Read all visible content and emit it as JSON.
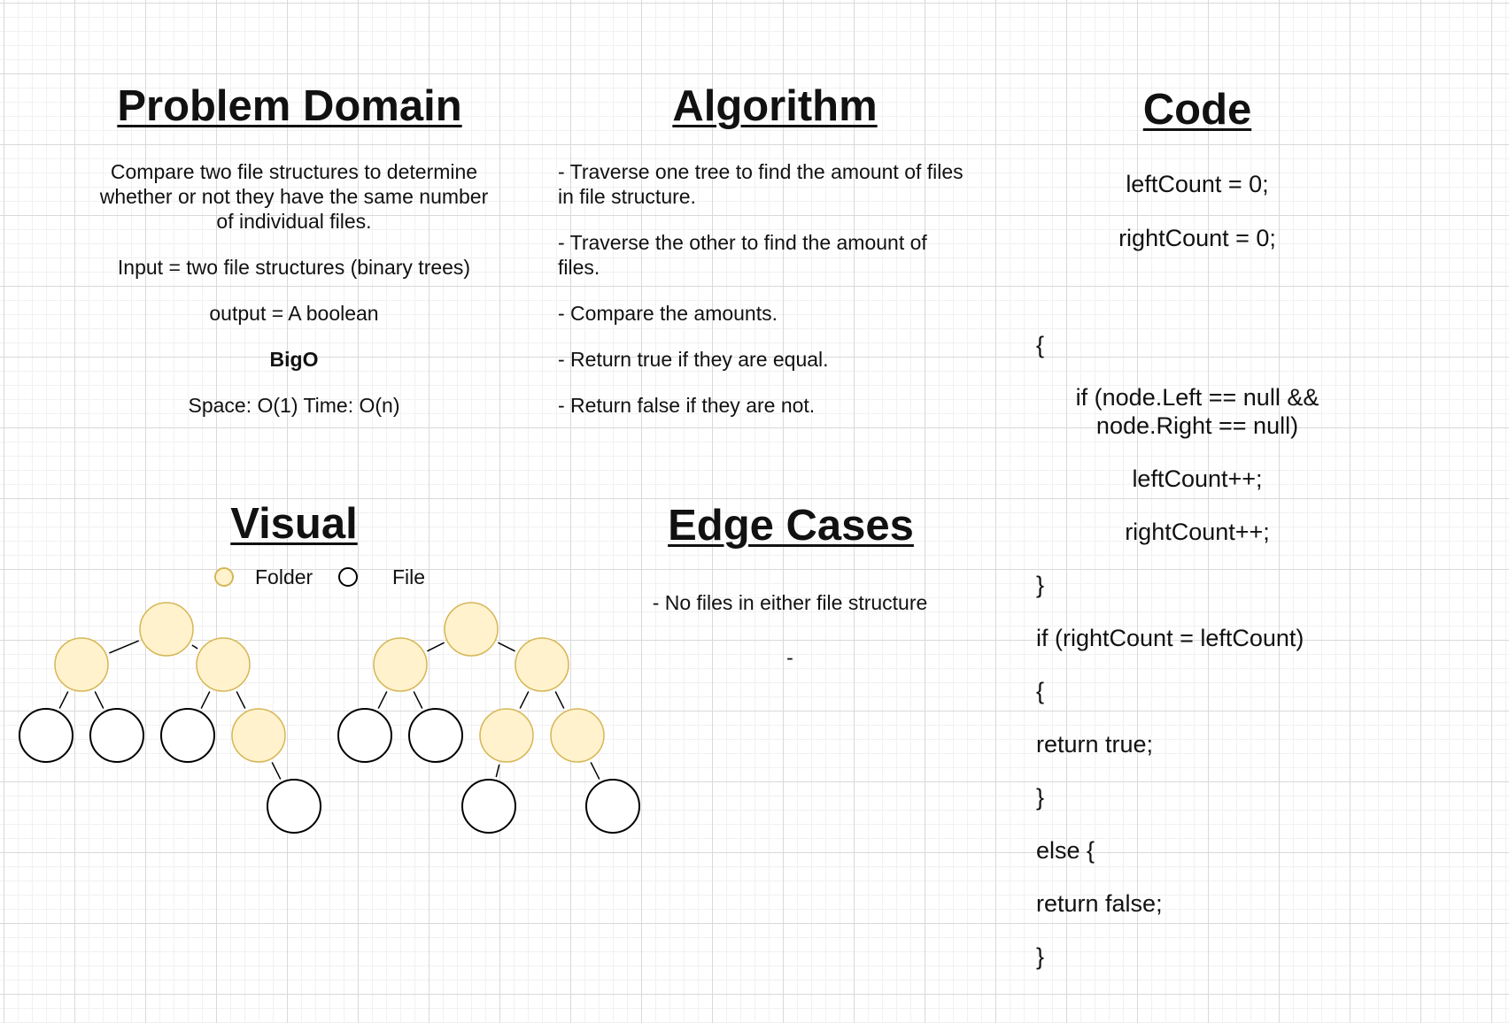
{
  "problem_domain": {
    "title": "Problem Domain",
    "desc_lines": [
      "Compare two file structures to determine",
      "whether or not they have the same number",
      "of individual files."
    ],
    "input": "Input = two file structures (binary trees)",
    "output": "output = A boolean",
    "bigo_label": "BigO",
    "complexity": "Space: O(1) Time: O(n)"
  },
  "algorithm": {
    "title": "Algorithm",
    "steps": [
      [
        "- Traverse one tree to find the amount of files",
        "in file structure."
      ],
      [
        "- Traverse the other to find the amount of",
        "files."
      ],
      [
        "- Compare the amounts."
      ],
      [
        "- Return true if they are equal."
      ],
      [
        "- Return false if they are not."
      ]
    ]
  },
  "code": {
    "title": "Code",
    "lines": [
      "leftCount = 0;",
      "rightCount = 0;",
      "{",
      "if (node.Left == null &&",
      "node.Right == null)",
      "leftCount++;",
      "rightCount++;",
      "}",
      "if (rightCount = leftCount)",
      "{",
      "return true;",
      "}",
      "else {",
      "return false;",
      "}"
    ]
  },
  "visual": {
    "title": "Visual",
    "legend_folder": "Folder",
    "legend_file": "File",
    "folder_color": "#fff2cc",
    "folder_stroke": "#d6b656",
    "file_color": "#ffffff",
    "file_stroke": "#000000"
  },
  "edge_cases": {
    "title": "Edge Cases",
    "items": [
      "- No files in either file structure",
      "-"
    ]
  }
}
